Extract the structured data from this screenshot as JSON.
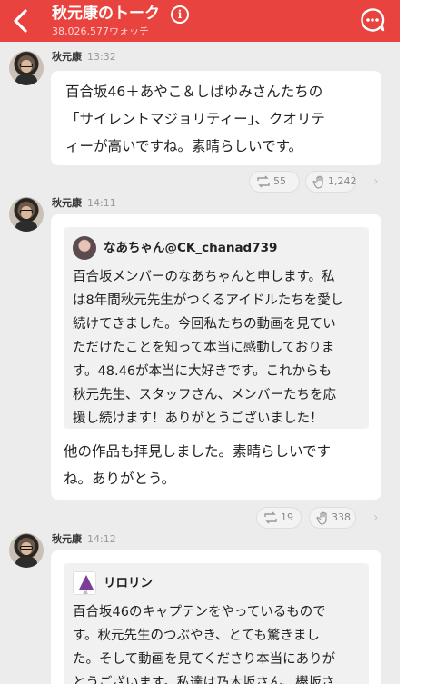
{
  "header": {
    "title": "秋元康のトーク",
    "subtitle": "38,026,577ウォッチ",
    "info_icon": "info-icon",
    "back_icon": "chevron-left-icon",
    "chat_icon": "chat-bubble-icon",
    "color": "#e8433f"
  },
  "messages": [
    {
      "author": "秋元康",
      "time": "13:32",
      "text": [
        "百合坂46＋あやこ＆しばゆみさんたちの",
        "「サイレントマジョリティー」、クオリテ",
        "ィーが高いですね。素晴らしいです。"
      ],
      "repost_count": "55",
      "like_count": "1,242"
    },
    {
      "author": "秋元康",
      "time": "14:11",
      "quote": {
        "name": "なあちゃん@CK_chanad739",
        "lines": [
          "百合坂メンバーのなあちゃんと申します。私",
          "は8年間秋元先生がつくるアイドルたちを愛し",
          "続けてきました。今回私たちの動画を見てい",
          "ただけたことを知って本当に感動しておりま",
          "す。48.46が本当に大好きです。これからも",
          "秋元先生、スタッフさん、メンバーたちを応",
          "援し続けます！ありがとうございました！"
        ]
      },
      "text": [
        "他の作品も拝見しました。素晴らしいです",
        "ね。ありがとう。"
      ],
      "repost_count": "19",
      "like_count": "338"
    },
    {
      "author": "秋元康",
      "time": "14:12",
      "quote": {
        "name": "リロリン",
        "lines": [
          "百合坂46のキャプテンをやっているもので",
          "す。秋元先生のつぶやき、とても驚きまし",
          "た。そして動画を見てくださり本当にありが",
          "とうございます。私達は乃木坂さん、欅坂さ"
        ]
      }
    }
  ]
}
